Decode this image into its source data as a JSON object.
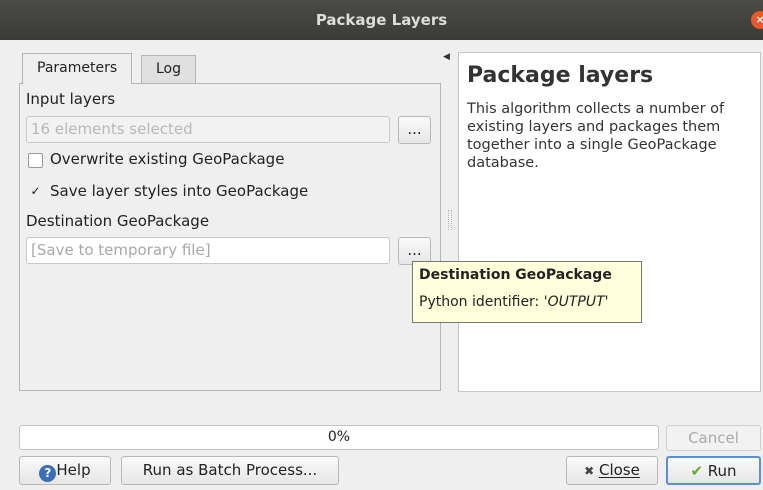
{
  "window": {
    "title": "Package Layers",
    "close_symbol": "×"
  },
  "tabs": [
    "Parameters",
    "Log"
  ],
  "form": {
    "input_layers_label": "Input layers",
    "input_layers_value": "16 elements selected",
    "browse_label": "...",
    "overwrite_label": "Overwrite existing GeoPackage",
    "overwrite_checked": false,
    "save_styles_label": "Save layer styles into GeoPackage",
    "save_styles_checked": true,
    "check_mark": "✓",
    "destination_label": "Destination GeoPackage",
    "destination_value": "[Save to temporary file]"
  },
  "tooltip": {
    "title": "Destination GeoPackage",
    "prefix": "Python identifier: '",
    "identifier": "OUTPUT",
    "suffix": "'"
  },
  "help": {
    "title": "Package layers",
    "body": "This algorithm collects a number of existing layers and packages them together into a single GeoPackage database."
  },
  "progress": {
    "text": "0%",
    "value": 0
  },
  "buttons": {
    "cancel": "Cancel",
    "help": "Help",
    "batch": "Run as Batch Process...",
    "close": "Close",
    "run": "Run"
  },
  "icons": {
    "collapse_arrow": "◀",
    "help": "?",
    "close": "✖",
    "run": "✔"
  },
  "colors": {
    "titlebar": "#3b3b38",
    "close_button": "#e8582a",
    "tooltip_bg": "#ffffdc",
    "run_border": "#5a8fd0"
  }
}
